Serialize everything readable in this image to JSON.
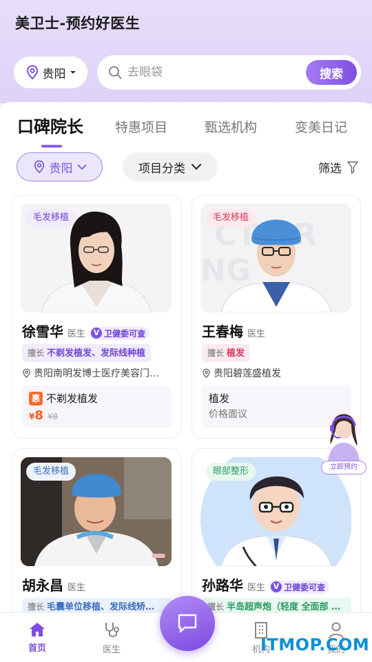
{
  "header": {
    "app_title": "美卫士-预约好医生",
    "city": "贵阳",
    "search_placeholder": "去眼袋",
    "search_button": "搜索"
  },
  "tabs": [
    {
      "label": "口碑院长",
      "active": true
    },
    {
      "label": "特惠项目",
      "active": false
    },
    {
      "label": "甄选机构",
      "active": false
    },
    {
      "label": "变美日记",
      "active": false
    }
  ],
  "filters": {
    "city": "贵阳",
    "category": "项目分类",
    "screen": "筛选"
  },
  "doctors": [
    {
      "category": "毛发移植",
      "name": "徐雪华",
      "title": "医生",
      "verified_label": "卫健委可查",
      "skill_key": "擅长",
      "skills": "不剃发植发、发际线种植",
      "location": "贵阳南明发博士医疗美容门…",
      "promo_badge": "惠",
      "promo_item": "不剃发植发",
      "currency": "¥",
      "price": "8",
      "original_price": "¥8"
    },
    {
      "category": "毛发移植",
      "name": "王春梅",
      "title": "医生",
      "skill_key": "擅长",
      "skills": "植发",
      "location": "贵阳碧莲盛植发",
      "promo_item": "植发",
      "promo_price_text": "价格面议"
    },
    {
      "category": "毛发移植",
      "name": "胡永昌",
      "title": "医生",
      "skill_key": "擅长",
      "skills": "毛囊单位移植、发际线矫…"
    },
    {
      "category": "眼部整形",
      "name": "孙路华",
      "title": "医生",
      "verified_label": "卫健委可查",
      "skill_key": "擅长",
      "skills": "半岛超声炮（轻度 全面部 …"
    }
  ],
  "assistant": {
    "label": "立即预约"
  },
  "bottom_nav": [
    {
      "label": "首页",
      "icon": "home-icon",
      "active": true
    },
    {
      "label": "医生",
      "icon": "stethoscope-icon",
      "active": false
    },
    {
      "label": "机构",
      "icon": "building-icon",
      "active": false
    },
    {
      "label": "我的",
      "icon": "user-icon",
      "active": false
    }
  ],
  "watermark": "ITMOP.COM",
  "colors": {
    "accent": "#7d4fe3",
    "header_bg": "#e7ddfb",
    "price": "#ff5a1f"
  }
}
